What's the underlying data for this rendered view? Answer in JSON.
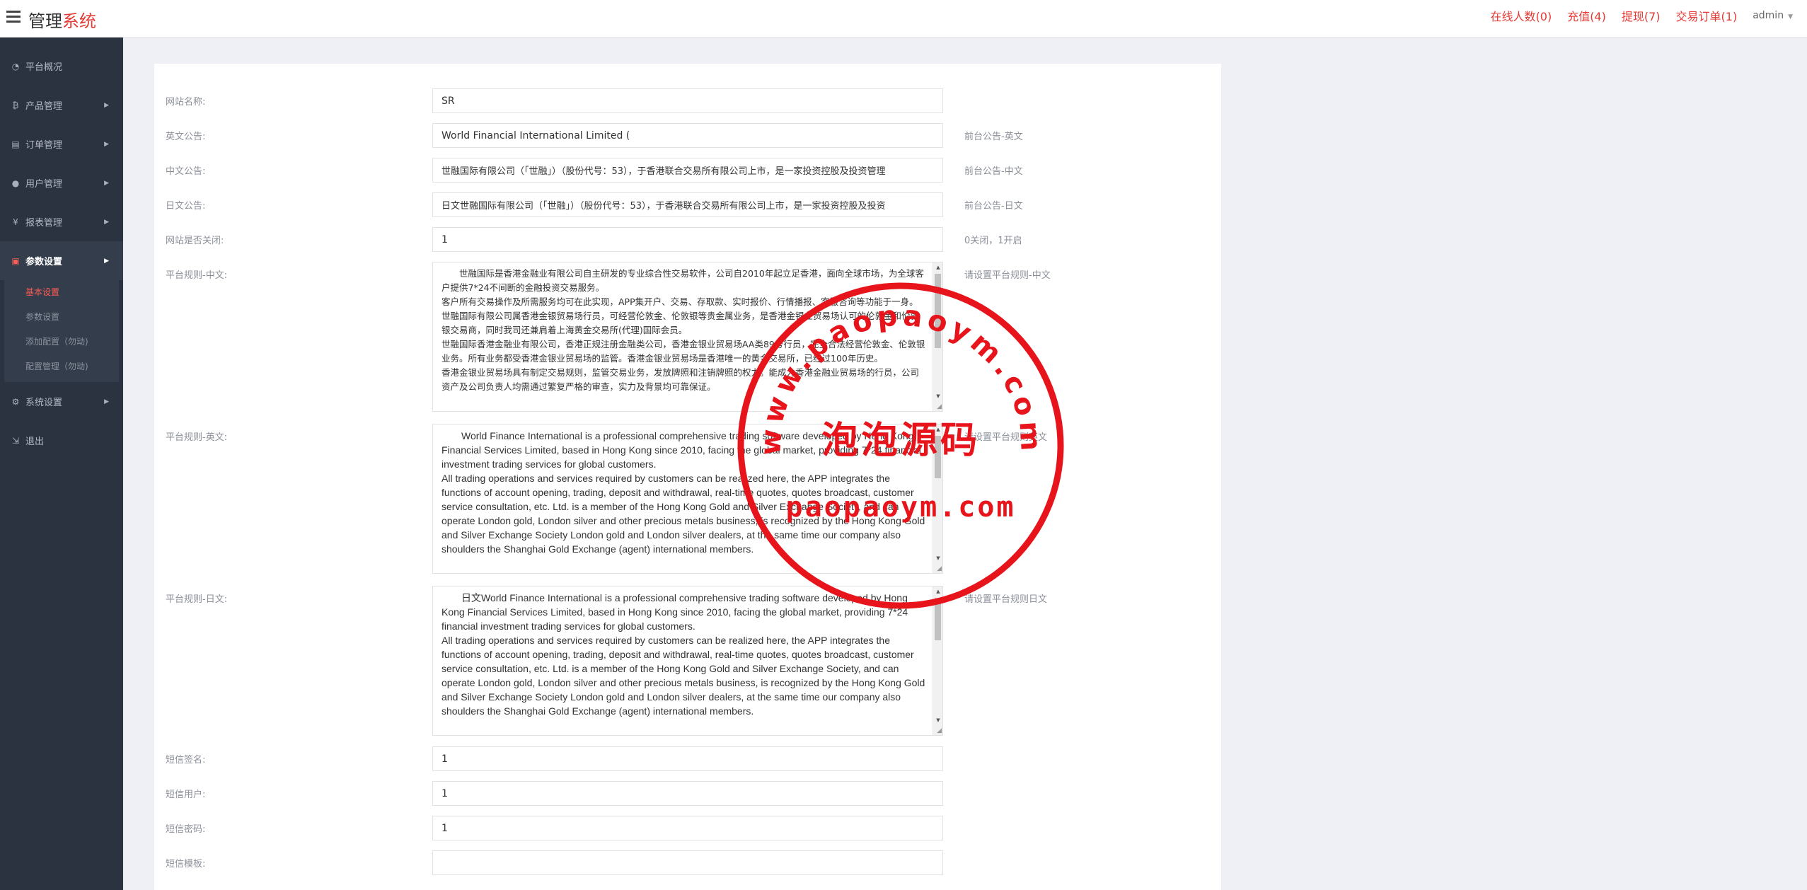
{
  "header": {
    "brand_main": "管理",
    "brand_accent": "系统",
    "links": [
      {
        "label": "在线人数(0)"
      },
      {
        "label": "充值(4)"
      },
      {
        "label": "提现(7)"
      },
      {
        "label": "交易订单(1)"
      }
    ],
    "user": "admin"
  },
  "sidebar": {
    "items": [
      {
        "label": "平台概况",
        "icon": "dashboard-icon"
      },
      {
        "label": "产品管理",
        "icon": "bitcoin-icon"
      },
      {
        "label": "订单管理",
        "icon": "order-icon"
      },
      {
        "label": "用户管理",
        "icon": "user-icon"
      },
      {
        "label": "报表管理",
        "icon": "yen-icon"
      },
      {
        "label": "参数设置",
        "icon": "settings-doc-icon"
      },
      {
        "label": "系统设置",
        "icon": "cogs-icon"
      },
      {
        "label": "退出",
        "icon": "logout-icon"
      }
    ],
    "subitems": [
      {
        "label": "基本设置"
      },
      {
        "label": "参数设置"
      },
      {
        "label": "添加配置（勿动)"
      },
      {
        "label": "配置管理（勿动)"
      }
    ]
  },
  "form": {
    "site_name": {
      "label": "网站名称:",
      "value": "SR"
    },
    "en_notice": {
      "label": "英文公告:",
      "value": "World Financial International Limited (",
      "hint": "前台公告-英文"
    },
    "cn_notice": {
      "label": "中文公告:",
      "value": "世融国际有限公司（「世融」）（股份代号：53），于香港联合交易所有限公司上市，是一家投资控股及投资管理",
      "hint": "前台公告-中文"
    },
    "jp_notice": {
      "label": "日文公告:",
      "value": "日文世融国际有限公司（「世融」）（股份代号：53），于香港联合交易所有限公司上市，是一家投资控股及投资",
      "hint": "前台公告-日文"
    },
    "site_closed": {
      "label": "网站是否关闭:",
      "value": "1",
      "hint": "0关闭，1开启"
    },
    "rules_cn": {
      "label": "平台规则-中文:",
      "hint": "请设置平台规则-中文",
      "text": "世融国际是香港金融业有限公司自主研发的专业综合性交易软件，公司自2010年起立足香港，面向全球市场，为全球客户提供7*24不间断的金融投资交易服务。\n客户所有交易操作及所需服务均可在此实现，APP集开户、交易、存取款、实时报价、行情播报、客服咨询等功能于一身。世融国际有限公司属香港金银贸易场行员，可经营伦敦金、伦敦银等贵金属业务，是香港金银业贸易场认可的伦敦金和伦敦银交易商，同时我司还兼肩着上海黄金交易所(代理)国际会员。\n世融国际香港金融业有限公司，香港正规注册金融类公司，香港金银业贸易场AA类89号行员，完全合法经营伦敦金、伦敦银业务。所有业务都受香港金银业贸易场的监管。香港金银业贸易场是香港唯一的黄金交易所，已经过100年历史。\n香港金银业贸易场具有制定交易规则，监管交易业务，发放牌照和注销牌照的权力。能成为香港金融业贸易场的行员，公司资产及公司负责人均需通过繁复严格的审查，实力及背景均可靠保证。"
    },
    "rules_en": {
      "label": "平台规则-英文:",
      "hint": "请设置平台规则英文",
      "text": "World Finance International is a professional comprehensive trading software developed by Hong Kong Financial Services Limited, based in Hong Kong since 2010, facing the global market, providing 7*24 financial investment trading services for global customers.\nAll trading operations and services required by customers can be realized here, the APP integrates the functions of account opening, trading, deposit and withdrawal, real-time quotes, quotes broadcast, customer service consultation, etc. Ltd. is a member of the Hong Kong Gold and Silver Exchange Society, and can operate London gold, London silver and other precious metals business, is recognized by the Hong Kong Gold and Silver Exchange Society London gold and London silver dealers, at the same time our company also shoulders the Shanghai Gold Exchange (agent) international members."
    },
    "rules_jp": {
      "label": "平台规则-日文:",
      "hint": "请设置平台规则日文",
      "text": "日文World Finance International is a professional comprehensive trading software developed by Hong Kong Financial Services Limited, based in Hong Kong since 2010, facing the global market, providing 7*24 financial investment trading services for global customers.\nAll trading operations and services required by customers can be realized here, the APP integrates the functions of account opening, trading, deposit and withdrawal, real-time quotes, quotes broadcast, customer service consultation, etc. Ltd. is a member of the Hong Kong Gold and Silver Exchange Society, and can operate London gold, London silver and other precious metals business, is recognized by the Hong Kong Gold and Silver Exchange Society London gold and London silver dealers, at the same time our company also shoulders the Shanghai Gold Exchange (agent) international members."
    },
    "sms_sign": {
      "label": "短信签名:",
      "value": "1"
    },
    "sms_user": {
      "label": "短信用户:",
      "value": "1"
    },
    "sms_password": {
      "label": "短信密码:",
      "value": "1"
    },
    "sms_template": {
      "label": "短信模板:",
      "value": ""
    }
  },
  "watermark": {
    "ring_text": "www.paopaoym.com",
    "center_text": "泡泡源码",
    "bottom_text": "paopaoym.com",
    "color": "#e8141b"
  },
  "colors": {
    "accent": "#e53935",
    "sidebar_bg": "#2b3341"
  }
}
